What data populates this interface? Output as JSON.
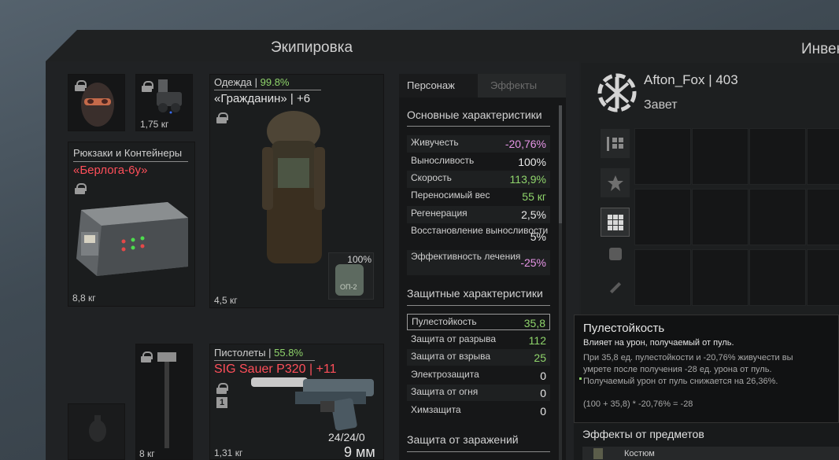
{
  "panel_title": "Экипировка",
  "inventory_title": "Инвен",
  "head": {
    "weight": ""
  },
  "nvg": {
    "weight": "1,75 кг"
  },
  "backpack": {
    "category": "Рюкзаки и Контейнеры",
    "name": "«Берлога-6у»",
    "weight": "8,8 кг"
  },
  "clothing": {
    "category": "Одежда",
    "durability": "99.8%",
    "name": "«Гражданин» | +6",
    "weight": "4,5 кг",
    "sub_item_percent": "100%",
    "sub_item_label": "ОП-2"
  },
  "melee": {
    "weight": "8 кг"
  },
  "pistol": {
    "category": "Пистолеты",
    "durability": "55.8%",
    "name": "SIG Sauer P320 | +11",
    "weight": "1,31 кг",
    "ammo": "24/24/0",
    "caliber": "9 мм",
    "slot_num": "1"
  },
  "tabs": {
    "character": "Персонаж",
    "effects": "Эффекты"
  },
  "sections": {
    "main": "Основные характеристики",
    "protection": "Защитные характеристики",
    "contamination": "Защита от заражений"
  },
  "main_stats": [
    {
      "name": "Живучесть",
      "value": "-20,76%",
      "color": "#e695e6"
    },
    {
      "name": "Выносливость",
      "value": "100%",
      "color": "#e8e8e8"
    },
    {
      "name": "Скорость",
      "value": "113,9%",
      "color": "#8fd46b"
    },
    {
      "name": "Переносимый вес",
      "value": "55 кг",
      "color": "#8fd46b"
    },
    {
      "name": "Регенерация",
      "value": "2,5%",
      "color": "#e8e8e8"
    },
    {
      "name": "Восстановление выносливости",
      "value": "5%",
      "color": "#e8e8e8"
    },
    {
      "name": "Эффективность лечения",
      "value": "-25%",
      "color": "#e695e6"
    }
  ],
  "protection_stats": [
    {
      "name": "Пулестойкость",
      "value": "35,8",
      "color": "#8fd46b"
    },
    {
      "name": "Защита от разрыва",
      "value": "112",
      "color": "#8fd46b"
    },
    {
      "name": "Защита от взрыва",
      "value": "25",
      "color": "#8fd46b"
    },
    {
      "name": "Электрозащита",
      "value": "0",
      "color": "#e8e8e8"
    },
    {
      "name": "Защита от огня",
      "value": "0",
      "color": "#e8e8e8"
    },
    {
      "name": "Химзащита",
      "value": "0",
      "color": "#e8e8e8"
    }
  ],
  "profile": {
    "name": "Afton_Fox | 403",
    "faction": "Завет"
  },
  "tooltip": {
    "title": "Пулестойкость",
    "subtitle": "Влияет на урон, получаемый от пуль.",
    "line1": "При 35,8 ед. пулестойкости и -20,76% живучести вы",
    "line2": "умрете после получения -28 ед. урона от пуль.",
    "line3": "Получаемый урон от пуль снижается на 26,36%.",
    "formula": "(100 + 35,8) * -20,76% = -28"
  },
  "effects": {
    "title": "Эффекты от предметов",
    "first_item": "Костюм"
  }
}
